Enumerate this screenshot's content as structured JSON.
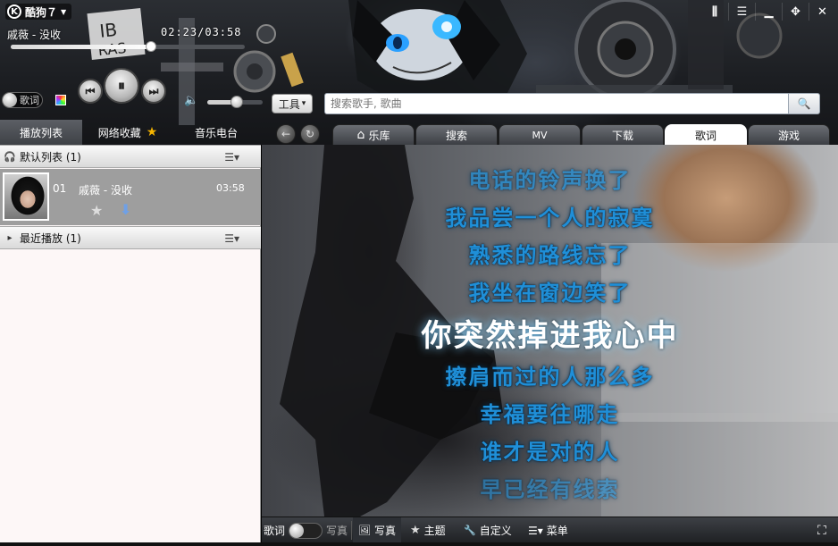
{
  "app": {
    "title": "酷狗７",
    "logo_glyph": "K",
    "menu_arrow": "▼"
  },
  "window_controls": {
    "buttons": [
      {
        "id": "mini",
        "glyph": "⫼"
      },
      {
        "id": "menu",
        "glyph": "☰"
      },
      {
        "id": "minimize",
        "glyph": "▁"
      },
      {
        "id": "move",
        "glyph": "✥"
      },
      {
        "id": "close",
        "glyph": "✕"
      }
    ]
  },
  "player": {
    "now_playing": "戚薇 - 没收",
    "time": "02:23/03:58",
    "progress": 0.6,
    "volume": 0.54,
    "lyrics_toggle_label": "歌词",
    "prev_glyph": "⏮",
    "pause_glyph": "⏸",
    "next_glyph": "⏭",
    "volume_glyph": "🔈"
  },
  "toolbar": {
    "tools_label": "工具",
    "tools_arrow": "▾",
    "search_placeholder": "搜索歌手, 歌曲",
    "search_icon": "🔍"
  },
  "left_tabs": [
    {
      "label": "播放列表",
      "active": true
    },
    {
      "label": "网络收藏",
      "active": false,
      "icon": "★"
    },
    {
      "label": "音乐电台",
      "active": false
    }
  ],
  "nav": {
    "back_glyph": "←",
    "refresh_glyph": "↻"
  },
  "right_tabs": [
    {
      "label": "乐库",
      "icon": "⌂",
      "active": false
    },
    {
      "label": "搜索",
      "active": false
    },
    {
      "label": "MV",
      "active": false
    },
    {
      "label": "下载",
      "active": false
    },
    {
      "label": "歌词",
      "active": true
    },
    {
      "label": "游戏",
      "active": false
    }
  ],
  "playlist": {
    "default_group": {
      "label": "默认列表 (1)",
      "icon": "🎧",
      "menu_glyph": "☰▾"
    },
    "tracks": [
      {
        "num": "01",
        "name": "戚薇 - 没收",
        "duration": "03:58",
        "star_glyph": "★",
        "download_glyph": "⬇"
      }
    ],
    "recent_group": {
      "label": "最近播放 (1)",
      "icon": "▸",
      "menu_glyph": "☰▾"
    }
  },
  "lyrics": {
    "lines": [
      {
        "text": "电话的铃声换了",
        "active": false
      },
      {
        "text": "我品尝一个人的寂寞",
        "active": false
      },
      {
        "text": "熟悉的路线忘了",
        "active": false
      },
      {
        "text": "我坐在窗边笑了",
        "active": false
      },
      {
        "text": "你突然掉进我心中",
        "active": true
      },
      {
        "text": "擦肩而过的人那么多",
        "active": false
      },
      {
        "text": "幸福要往哪走",
        "active": false
      },
      {
        "text": "谁才是对的人",
        "active": false
      },
      {
        "text": "早已经有线索",
        "active": false
      }
    ]
  },
  "bottom_bar": {
    "lyrics_label": "歌词",
    "photo_toggle_label": "写真",
    "photo_label": "写真",
    "photo_icon": "🖼",
    "theme_label": "主题",
    "theme_icon": "★",
    "custom_label": "自定义",
    "custom_icon": "🔧",
    "menu_label": "菜单",
    "menu_icon": "☰▾",
    "fullscreen_icon": "⛶"
  }
}
